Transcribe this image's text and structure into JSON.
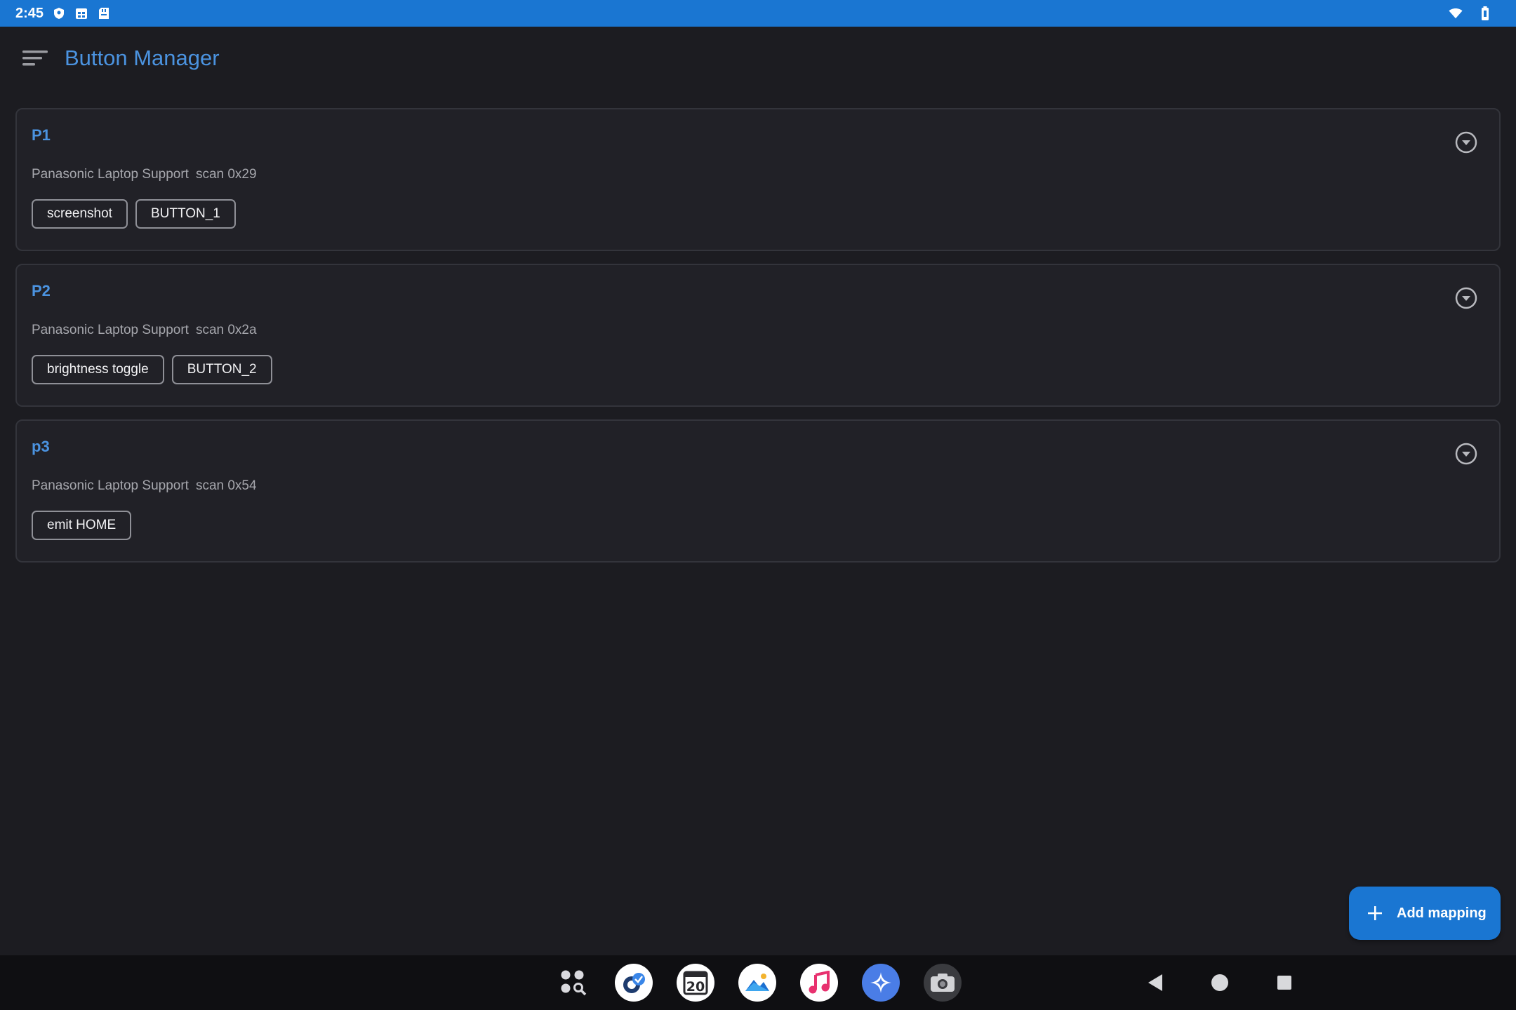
{
  "status_bar": {
    "time": "2:45"
  },
  "app_bar": {
    "title": "Button Manager"
  },
  "mappings": [
    {
      "title": "P1",
      "device": "Panasonic Laptop Support",
      "scan": "scan 0x29",
      "chips": [
        "screenshot",
        "BUTTON_1"
      ]
    },
    {
      "title": "P2",
      "device": "Panasonic Laptop Support",
      "scan": "scan 0x2a",
      "chips": [
        "brightness toggle",
        "BUTTON_2"
      ]
    },
    {
      "title": "p3",
      "device": "Panasonic Laptop Support",
      "scan": "scan 0x54",
      "chips": [
        "emit HOME"
      ]
    }
  ],
  "fab": {
    "label": "Add mapping"
  },
  "dock": {
    "apps": [
      {
        "icon": "app-drawer-search-icon"
      },
      {
        "icon": "messaging-app-icon"
      },
      {
        "icon": "calendar-app-icon",
        "label": "20"
      },
      {
        "icon": "gallery-app-icon"
      },
      {
        "icon": "music-app-icon"
      },
      {
        "icon": "assistant-app-icon"
      },
      {
        "icon": "camera-app-icon"
      }
    ]
  },
  "colors": {
    "accent": "#1a76d2",
    "title_blue": "#4b93e0",
    "background": "#1c1c21"
  }
}
